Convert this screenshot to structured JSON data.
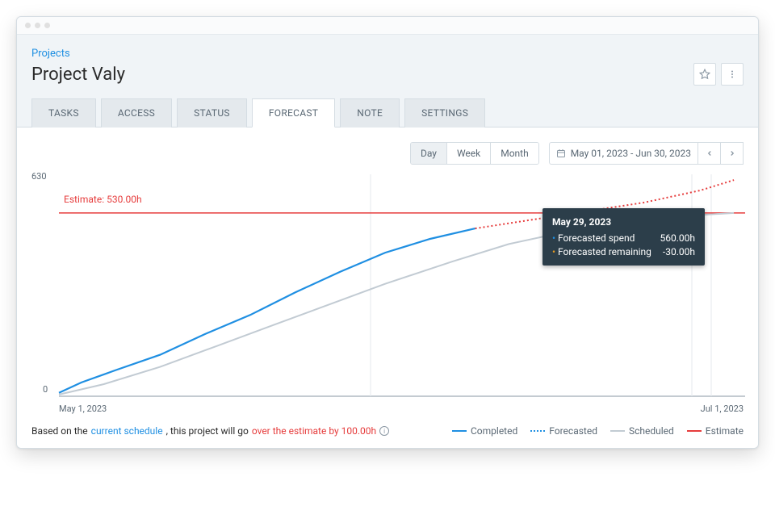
{
  "breadcrumb": "Projects",
  "page_title": "Project Valy",
  "tabs": [
    "TASKS",
    "ACCESS",
    "STATUS",
    "FORECAST",
    "NOTE",
    "SETTINGS"
  ],
  "active_tab": 3,
  "granularity": {
    "options": [
      "Day",
      "Week",
      "Month"
    ],
    "active": 0
  },
  "date_range": "May 01, 2023 - Jun 30, 2023",
  "axes": {
    "y_top": "630",
    "y_bottom": "0",
    "x_left": "May 1, 2023",
    "x_right": "Jul 1, 2023"
  },
  "estimate_label": "Estimate: 530.00h",
  "tooltip": {
    "title": "May 29, 2023",
    "rows": [
      {
        "label": "Forecasted spend",
        "value": "560.00h",
        "bullet": "#1f8fe2"
      },
      {
        "label": "Forecasted remaining",
        "value": "-30.00h",
        "bullet": "#e69a1f"
      }
    ]
  },
  "summary": {
    "prefix": "Based on the ",
    "link": "current schedule",
    "mid": ", this project will go ",
    "over": "over the estimate by 100.00h"
  },
  "legend": [
    {
      "label": "Completed",
      "style": "solid",
      "color": "#1f8fe2"
    },
    {
      "label": "Forecasted",
      "style": "dotted",
      "color": "#1f8fe2"
    },
    {
      "label": "Scheduled",
      "style": "solid",
      "color": "#c2cbd3"
    },
    {
      "label": "Estimate",
      "style": "solid",
      "color": "#e63c3c"
    }
  ],
  "chart_data": {
    "type": "line",
    "xlabel": "",
    "ylabel": "",
    "ylim": [
      0,
      630
    ],
    "x_range": [
      "2023-05-01",
      "2023-07-01"
    ],
    "estimate": 530,
    "series": [
      {
        "name": "Completed",
        "color": "#1f8fe2",
        "style": "solid",
        "points": [
          {
            "x": "2023-05-01",
            "y": 10
          },
          {
            "x": "2023-05-03",
            "y": 40
          },
          {
            "x": "2023-05-06",
            "y": 75
          },
          {
            "x": "2023-05-10",
            "y": 120
          },
          {
            "x": "2023-05-14",
            "y": 180
          },
          {
            "x": "2023-05-18",
            "y": 235
          },
          {
            "x": "2023-05-22",
            "y": 300
          },
          {
            "x": "2023-05-26",
            "y": 360
          },
          {
            "x": "2023-05-30",
            "y": 415
          },
          {
            "x": "2023-06-03",
            "y": 455
          },
          {
            "x": "2023-06-07",
            "y": 485
          }
        ]
      },
      {
        "name": "Forecasted",
        "color": "#1f8fe2",
        "style": "dotted",
        "points": [
          {
            "x": "2023-06-07",
            "y": 485
          },
          {
            "x": "2023-06-12",
            "y": 510
          },
          {
            "x": "2023-06-17",
            "y": 535
          },
          {
            "x": "2023-06-22",
            "y": 560
          },
          {
            "x": "2023-06-27",
            "y": 595
          },
          {
            "x": "2023-06-30",
            "y": 625
          }
        ]
      },
      {
        "name": "Scheduled",
        "color": "#c2cbd3",
        "style": "solid",
        "points": [
          {
            "x": "2023-05-01",
            "y": 5
          },
          {
            "x": "2023-05-05",
            "y": 35
          },
          {
            "x": "2023-05-10",
            "y": 85
          },
          {
            "x": "2023-05-15",
            "y": 145
          },
          {
            "x": "2023-05-20",
            "y": 205
          },
          {
            "x": "2023-05-25",
            "y": 265
          },
          {
            "x": "2023-05-30",
            "y": 325
          },
          {
            "x": "2023-06-05",
            "y": 390
          },
          {
            "x": "2023-06-10",
            "y": 440
          },
          {
            "x": "2023-06-15",
            "y": 475
          },
          {
            "x": "2023-06-20",
            "y": 500
          },
          {
            "x": "2023-06-25",
            "y": 520
          },
          {
            "x": "2023-06-30",
            "y": 530
          }
        ]
      }
    ]
  }
}
